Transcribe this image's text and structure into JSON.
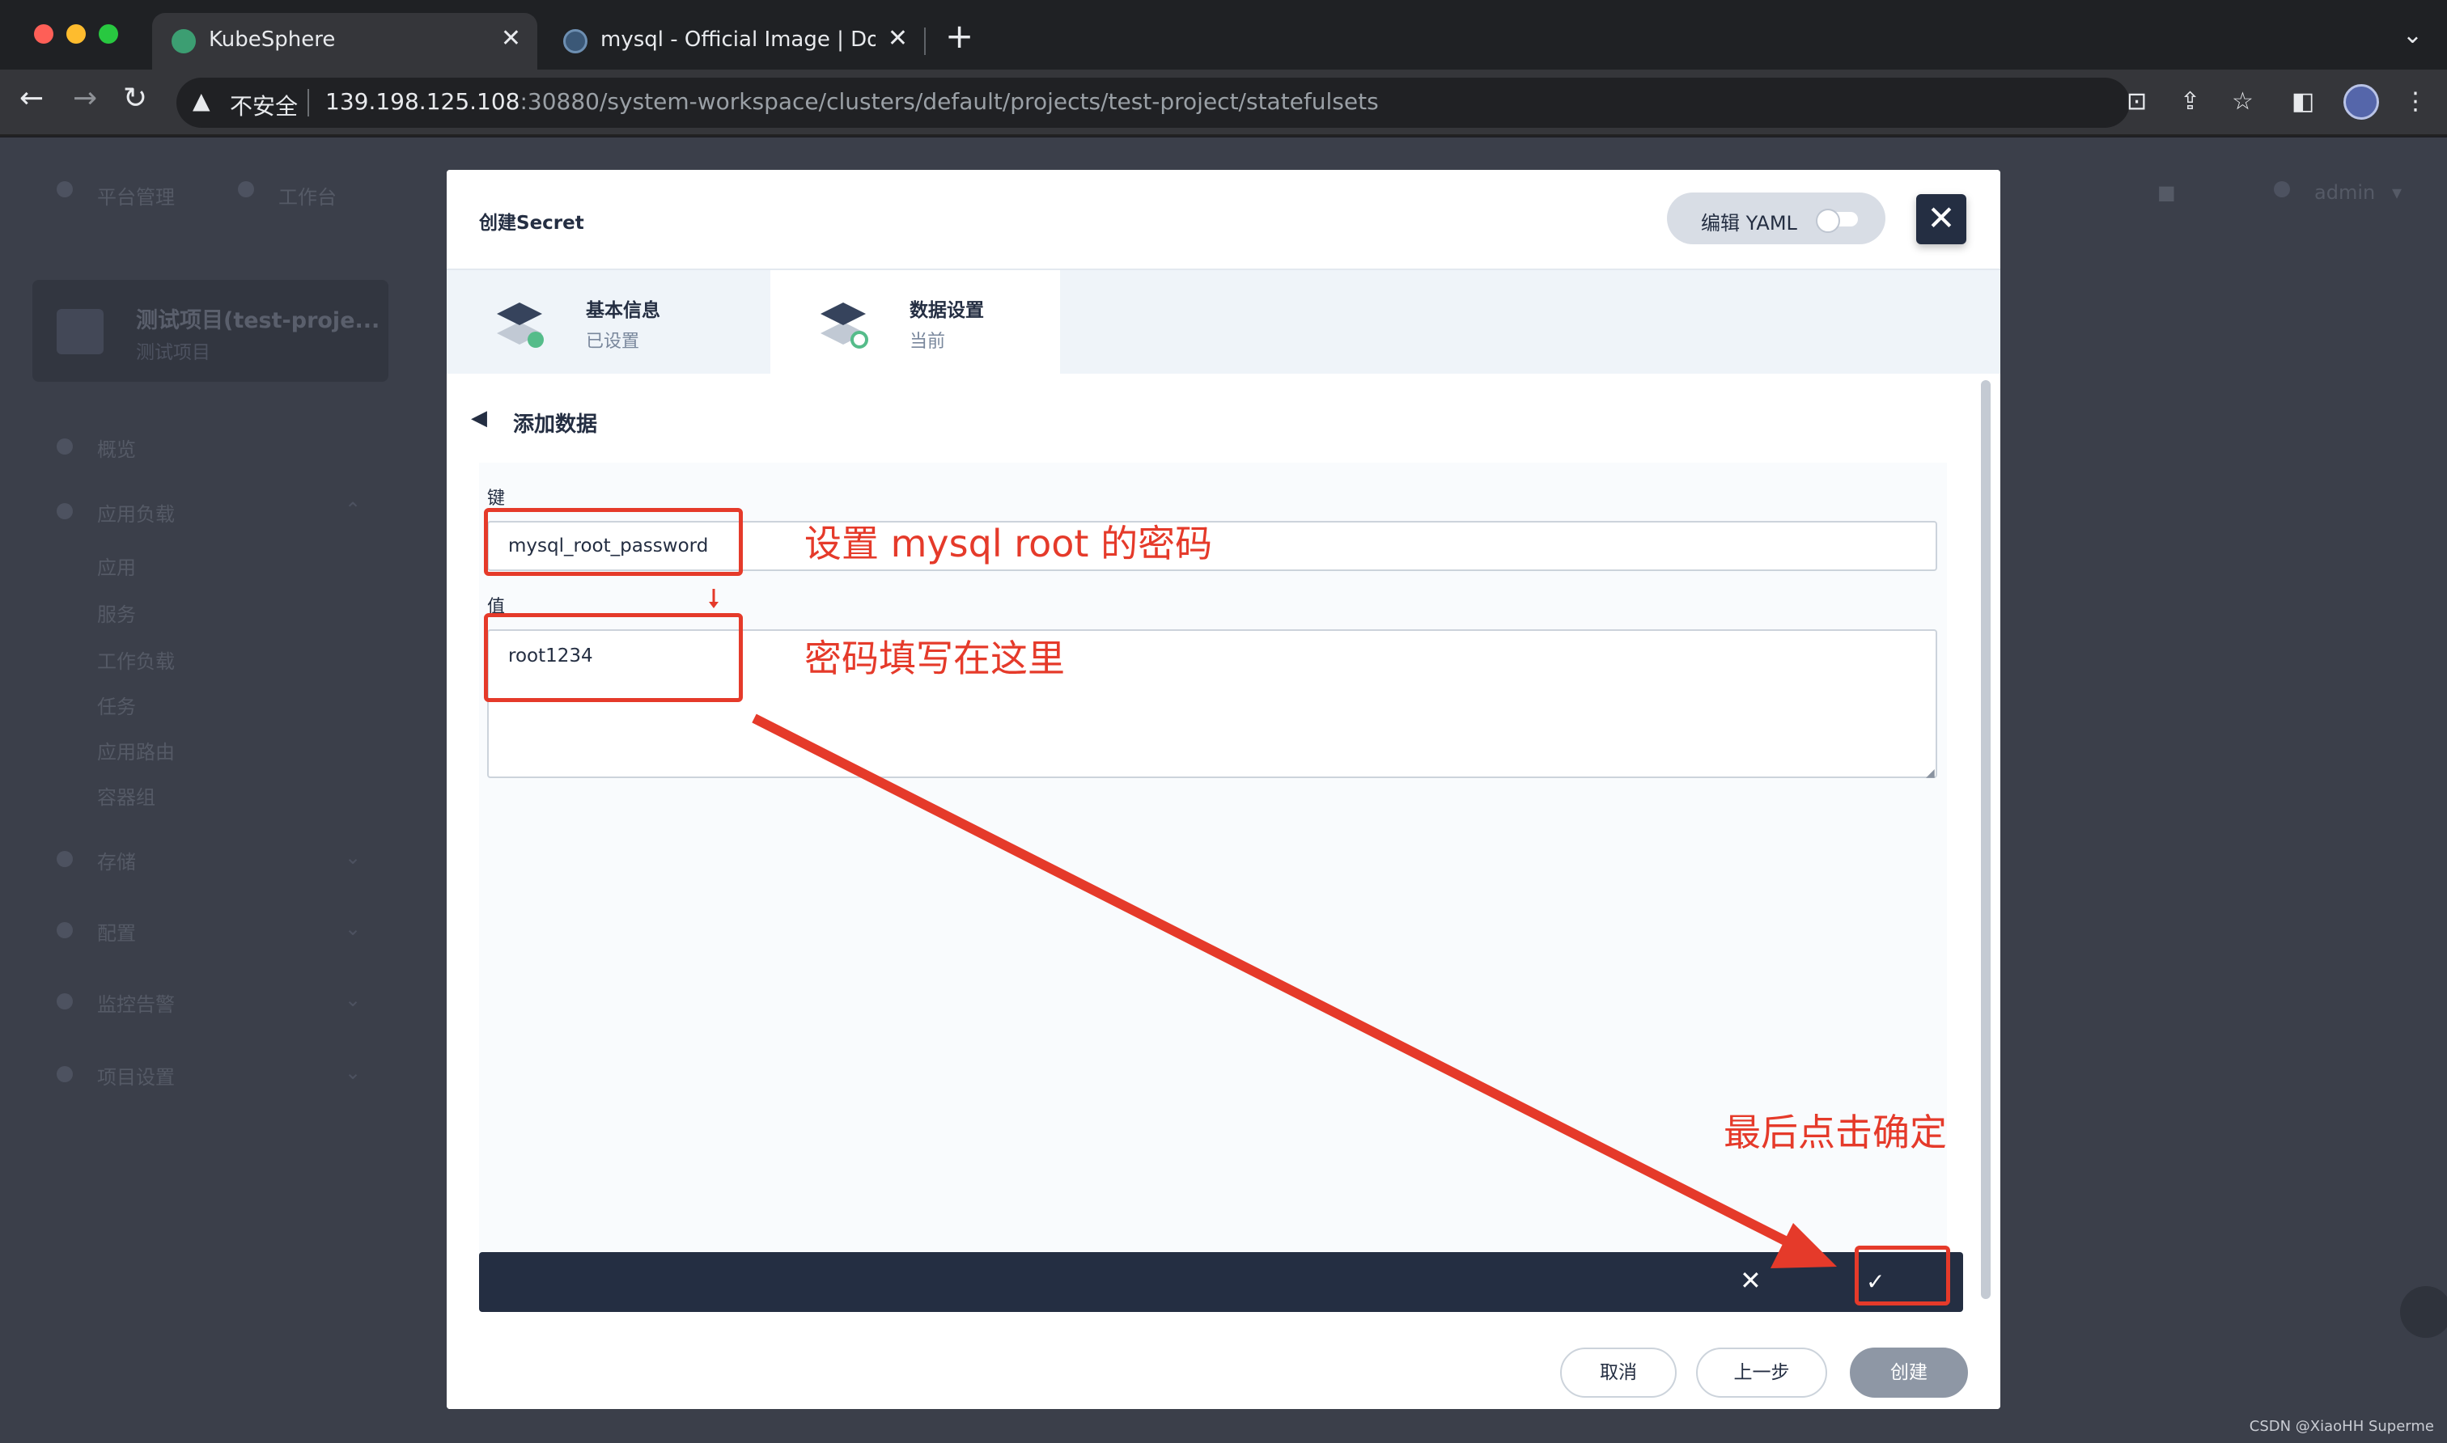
{
  "browser": {
    "tabs": [
      {
        "title": "KubeSphere",
        "active": true
      },
      {
        "title": "mysql - Official Image | Docker",
        "active": false
      }
    ],
    "address": {
      "security_label": "不安全",
      "host": "139.198.125.108",
      "path": ":30880/system-workspace/clusters/default/projects/test-project/statefulsets"
    }
  },
  "app_bg": {
    "top_nav": [
      "平台管理",
      "工作台"
    ],
    "user": "admin",
    "project": {
      "name": "测试项目(test-proje...",
      "sub": "测试项目"
    },
    "sidebar": [
      "概览",
      "应用负载",
      "应用",
      "服务",
      "工作负载",
      "任务",
      "应用路由",
      "容器组",
      "存储",
      "配置",
      "监控告警",
      "项目设置"
    ]
  },
  "modal": {
    "title": "创建Secret",
    "yaml_toggle_label": "编辑 YAML",
    "steps": [
      {
        "title": "基本信息",
        "status": "已设置"
      },
      {
        "title": "数据设置",
        "status": "当前"
      }
    ],
    "section_title": "添加数据",
    "key_label": "键",
    "key_value": "mysql_root_password",
    "value_label": "值",
    "value_value": "root1234",
    "footer": {
      "cancel": "取消",
      "prev": "上一步",
      "create": "创建"
    }
  },
  "annotations": {
    "key_note": "设置 mysql root 的密码",
    "value_note": "密码填写在这里",
    "confirm_note": "最后点击确定",
    "color": "#e53a2a"
  },
  "watermark": "CSDN @XiaoHH Superme",
  "colors": {
    "brand_dark": "#242e42",
    "success_green": "#55bc8a",
    "create_disabled": "#8e97a5"
  }
}
